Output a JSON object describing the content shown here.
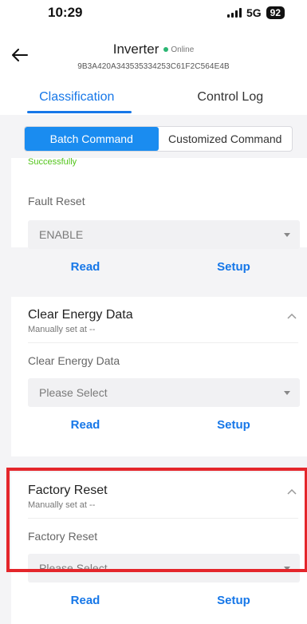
{
  "status_bar": {
    "time": "10:29",
    "network": "5G",
    "battery": "92"
  },
  "header": {
    "title": "Inverter",
    "status": "Online",
    "device_id": "9B3A420A343535334253C61F2C564E4B"
  },
  "tabs": [
    {
      "label": "Classification",
      "active": true
    },
    {
      "label": "Control Log",
      "active": false
    }
  ],
  "segments": [
    {
      "label": "Batch Command",
      "active": true
    },
    {
      "label": "Customized Command",
      "active": false
    }
  ],
  "cards": [
    {
      "partial_status": "Successfully",
      "field_label": "Fault Reset",
      "select_value": "ENABLE",
      "read_label": "Read",
      "setup_label": "Setup"
    },
    {
      "title": "Clear Energy Data",
      "subtitle": "Manually set at --",
      "field_label": "Clear Energy Data",
      "select_placeholder": "Please Select",
      "read_label": "Read",
      "setup_label": "Setup"
    },
    {
      "title": "Factory Reset",
      "subtitle": "Manually set at --",
      "field_label": "Factory Reset",
      "select_placeholder": "Please Select",
      "read_label": "Read",
      "setup_label": "Setup"
    }
  ],
  "colors": {
    "accent": "#1677e8",
    "online": "#2bb673",
    "highlight": "#e4262b",
    "success": "#52c41a"
  }
}
